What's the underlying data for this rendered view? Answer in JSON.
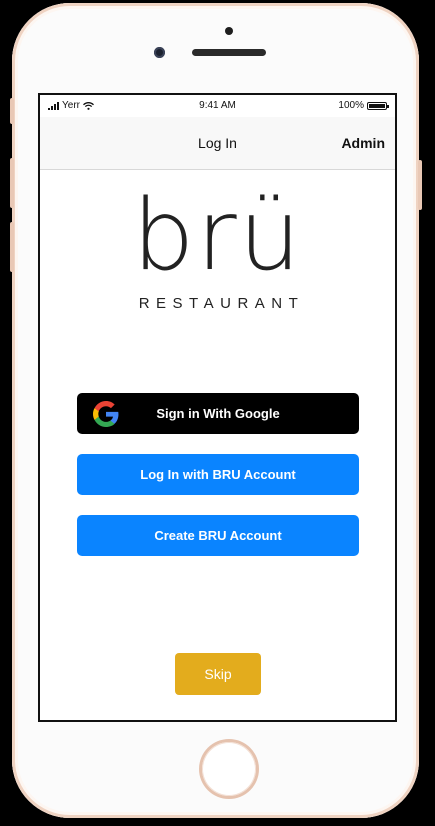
{
  "status_bar": {
    "carrier": "Yerr",
    "time": "9:41 AM",
    "battery_text": "100%",
    "battery_level": 1.0
  },
  "nav": {
    "title": "Log In",
    "admin_label": "Admin"
  },
  "logo": {
    "word": "brü",
    "subtitle": "RESTAURANT"
  },
  "buttons": {
    "google": "Sign in With Google",
    "login": "Log In with BRU Account",
    "create": "Create BRU Account",
    "skip": "Skip"
  },
  "colors": {
    "primary_blue": "#0a84ff",
    "google_button": "#000000",
    "skip_yellow": "#e3ac1d"
  },
  "icons": {
    "google": "google-g-icon",
    "signal": "cellular-signal-icon",
    "wifi": "wifi-icon",
    "battery": "battery-icon"
  }
}
